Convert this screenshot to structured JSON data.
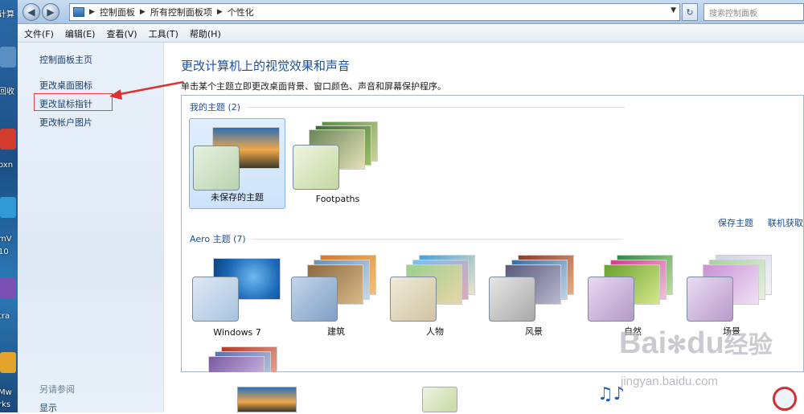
{
  "address": {
    "segments": [
      "控制面板",
      "所有控制面板项",
      "个性化"
    ],
    "search_placeholder": "搜索控制面板"
  },
  "menu": [
    "文件(F)",
    "编辑(E)",
    "查看(V)",
    "工具(T)",
    "帮助(H)"
  ],
  "nav": {
    "home": "控制面板主页",
    "items": [
      "更改桌面图标",
      "更改鼠标指针",
      "更改帐户图片"
    ],
    "see_also": "另请参阅",
    "display": "显示"
  },
  "main": {
    "title": "更改计算机上的视觉效果和声音",
    "subtitle": "单击某个主题立即更改桌面背景、窗口颜色、声音和屏幕保护程序。",
    "my_themes_label": "我的主题 (2)",
    "my_themes": [
      "未保存的主题",
      "Footpaths"
    ],
    "save_theme": "保存主题",
    "online_themes": "联机获取",
    "aero_label": "Aero 主题 (7)",
    "aero_themes": [
      "Windows 7",
      "建筑",
      "人物",
      "风景",
      "自然",
      "场景"
    ]
  },
  "desktop_labels": [
    "计算",
    "回收",
    "oxn",
    "mV",
    "10",
    "tra",
    "Mw",
    "rks"
  ],
  "watermark": {
    "brand": "Bai",
    "brand2": "du",
    "brand3": "经验",
    "url": "jingyan.baidu.com"
  },
  "colors": {
    "link": "#1c3d6b",
    "title": "#1e4f9a",
    "highlight": "#e84040"
  }
}
